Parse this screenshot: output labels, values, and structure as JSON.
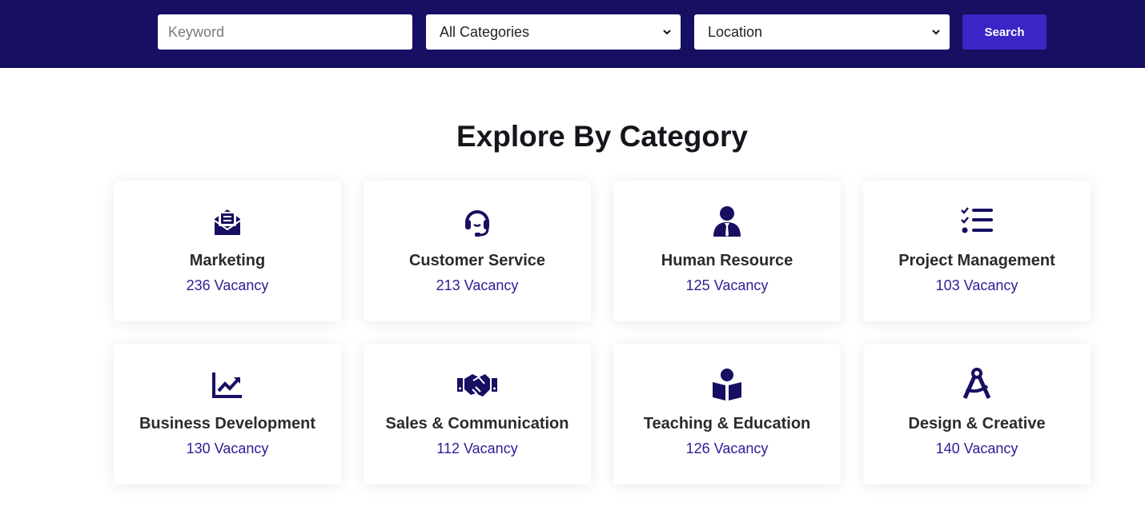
{
  "search": {
    "keyword_placeholder": "Keyword",
    "category_value": "All Categories",
    "location_value": "Location",
    "button_label": "Search"
  },
  "section": {
    "title": "Explore By Category"
  },
  "categories": [
    {
      "icon": "envelope-open-text-icon",
      "title": "Marketing",
      "count": "236 Vacancy"
    },
    {
      "icon": "headset-icon",
      "title": "Customer Service",
      "count": "213 Vacancy"
    },
    {
      "icon": "user-tie-icon",
      "title": "Human Resource",
      "count": "125 Vacancy"
    },
    {
      "icon": "list-check-icon",
      "title": "Project Management",
      "count": "103 Vacancy"
    },
    {
      "icon": "chart-line-icon",
      "title": "Business Development",
      "count": "130 Vacancy"
    },
    {
      "icon": "handshake-icon",
      "title": "Sales & Communication",
      "count": "112 Vacancy"
    },
    {
      "icon": "book-reader-icon",
      "title": "Teaching & Education",
      "count": "126 Vacancy"
    },
    {
      "icon": "drafting-compass-icon",
      "title": "Design & Creative",
      "count": "140 Vacancy"
    }
  ],
  "colors": {
    "header_bg": "#160f62",
    "button_bg": "#3b25c6",
    "icon": "#160f62",
    "count_text": "#2d2094"
  }
}
